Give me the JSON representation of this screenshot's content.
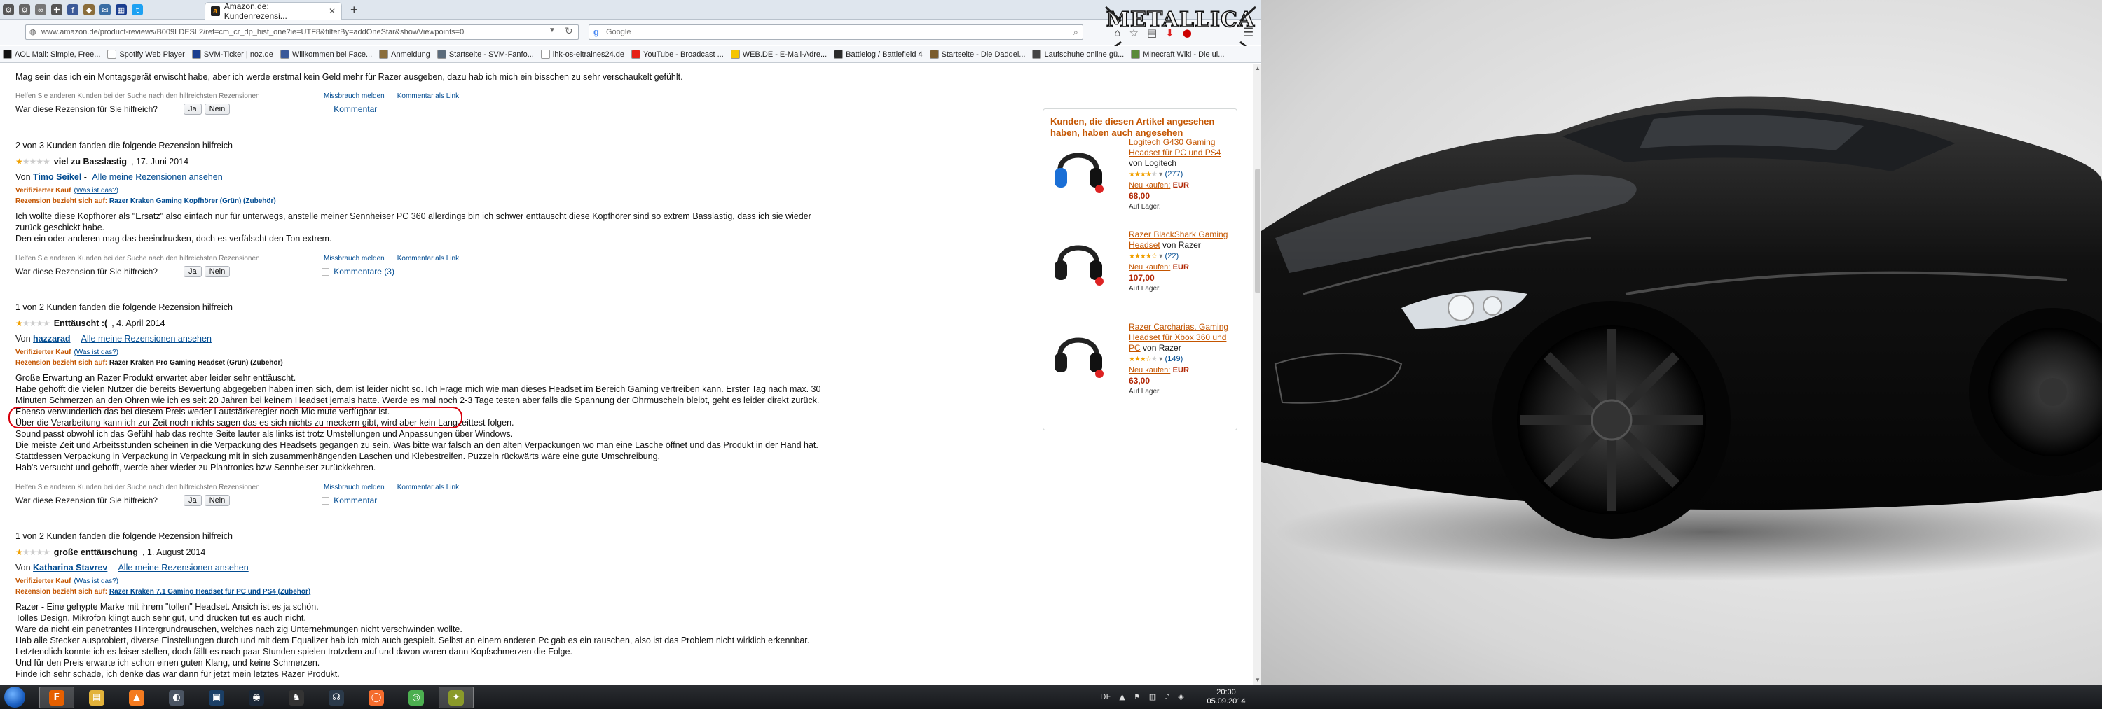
{
  "browser": {
    "tab_title": "Amazon.de: Kundenrezensi...",
    "url": "www.amazon.de/product-reviews/B009LDESL2/ref=cm_cr_dp_hist_one?ie=UTF8&filterBy=addOneStar&showViewpoints=0",
    "search_placeholder": "Google",
    "overlay_logo_text": "METALLICA"
  },
  "bookmarks": [
    {
      "label": "AOL Mail: Simple, Free...",
      "color": "#111111"
    },
    {
      "label": "Spotify Web Player",
      "color": "#ffffff"
    },
    {
      "label": "SVM-Ticker | noz.de",
      "color": "#1a3d8f"
    },
    {
      "label": "Willkommen bei Face...",
      "color": "#3b5998"
    },
    {
      "label": "Anmeldung",
      "color": "#8a6d3b"
    },
    {
      "label": "Startseite - SVM-Fanfo...",
      "color": "#5b6b7b"
    },
    {
      "label": "ihk-os-eltraines24.de",
      "color": "#ffffff"
    },
    {
      "label": "YouTube - Broadcast ...",
      "color": "#e62117"
    },
    {
      "label": "WEB.DE - E-Mail-Adre...",
      "color": "#f5c400"
    },
    {
      "label": "Battlelog / Battlefield 4",
      "color": "#2b2b2b"
    },
    {
      "label": "Startseite - Die Daddel...",
      "color": "#7a5c2e"
    },
    {
      "label": "Laufschuhe online gü...",
      "color": "#444444"
    },
    {
      "label": "Minecraft Wiki - Die ul...",
      "color": "#5a8a3a"
    }
  ],
  "reviews": {
    "top_text": "Mag sein das ich ein Montagsgerät erwischt habe, aber ich werde erstmal kein Geld mehr für Razer ausgeben, dazu hab ich mich ein bisschen zu sehr verschaukelt gefühlt.",
    "feedback_help_label": "Helfen Sie anderen Kunden bei der Suche nach den hilfreichsten Rezensionen",
    "report_abuse": "Missbrauch melden",
    "permalink": "Kommentar als Link",
    "helpful_question": "War diese Rezension für Sie hilfreich?",
    "yes": "Ja",
    "no": "Nein",
    "comment_1": "Kommentar",
    "verified_label": "Verifizierter Kauf",
    "what_is_this": "(Was ist das?)",
    "relates_label": "Rezension bezieht sich auf:",
    "all_reviews": "Alle meine Rezensionen ansehen",
    "r1": {
      "helpful": "2 von 3 Kunden fanden die folgende Rezension hilfreich",
      "title": "viel zu Basslastig",
      "date": ", 17. Juni 2014",
      "by": "Von",
      "author": "Timo Seikel",
      "product": "Razer Kraken Gaming Kopfhörer (Grün) (Zubehör)",
      "lines": [
        "Ich wollte diese Kopfhörer als \"Ersatz\" also einfach nur für unterwegs, anstelle meiner Sennheiser PC 360 allerdings bin ich schwer enttäuscht diese Kopfhörer sind so extrem Basslastig, dass ich sie wieder",
        "zurück geschickt habe.",
        "Den ein oder anderen mag das beeindrucken, doch es verfälscht den Ton extrem."
      ],
      "comments": "Kommentare (3)"
    },
    "r2": {
      "helpful": "1 von 2 Kunden fanden die folgende Rezension hilfreich",
      "title": "Enttäuscht :(",
      "date": ", 4. April 2014",
      "by": "Von",
      "author": "hazzarad",
      "product": "Razer Kraken Pro Gaming Headset (Grün) (Zubehör)",
      "lines": [
        "Große Erwartung an Razer Produkt erwartet aber leider sehr enttäuscht.",
        "Habe gehofft die vielen Nutzer die bereits Bewertung abgegeben haben irren sich, dem ist leider nicht so. Ich Frage mich wie man dieses Headset im Bereich Gaming vertreiben kann. Erster Tag nach max. 30",
        "Minuten Schmerzen an den Ohren wie ich es seit 20 Jahren bei keinem Headset jemals hatte. Werde es mal noch 2-3 Tage testen aber falls die Spannung der Ohrmuscheln bleibt, geht es leider direkt zurück.",
        "Ebenso verwunderlich das bei diesem Preis weder Lautstärkeregler noch Mic mute verfügbar ist.",
        "Über die Verarbeitung kann ich zur Zeit noch nichts sagen das es sich nichts zu meckern gibt, wird aber kein Langzeittest folgen.",
        "Sound passt obwohl ich das Gefühl hab das rechte Seite lauter als links ist trotz Umstellungen und Anpassungen über Windows.",
        "Die meiste Zeit und Arbeitsstunden scheinen in die Verpackung des Headsets gegangen zu sein. Was bitte war falsch an den alten Verpackungen wo man eine Lasche öffnet und das Produkt in der Hand hat.",
        "Stattdessen Verpackung in Verpackung in Verpackung mit in sich zusammenhängenden Laschen und Klebestreifen. Puzzeln rückwärts wäre eine gute Umschreibung.",
        "Hab's versucht und gehofft, werde aber wieder zu Plantronics bzw Sennheiser zurückkehren."
      ],
      "comments": "Kommentar"
    },
    "r3": {
      "helpful": "1 von 2 Kunden fanden die folgende Rezension hilfreich",
      "title": "große enttäuschung",
      "date": ", 1. August 2014",
      "by": "Von",
      "author": "Katharina Stavrev",
      "product": "Razer Kraken 7.1 Gaming Headset für PC und PS4 (Zubehör)",
      "lines": [
        "Razer - Eine gehypte Marke mit ihrem \"tollen\" Headset. Ansich ist es ja schön.",
        "Tolles Design, Mikrofon klingt auch sehr gut, und drücken tut es auch nicht.",
        "Wäre da nicht ein penetrantes Hintergrundrauschen, welches nach zig Unternehmungen nicht verschwinden wollte.",
        "Hab alle Stecker ausprobiert, diverse Einstellungen durch und mit dem Equalizer hab ich mich auch gespielt. Selbst an einem anderen Pc gab es ein rauschen, also ist das Problem nicht wirklich erkennbar.",
        "Letztendlich konnte ich es leiser stellen, doch fällt es nach paar Stunden spielen trotzdem auf und davon waren dann Kopfschmerzen die Folge.",
        "Und für den Preis erwarte ich schon einen guten Klang, und keine Schmerzen.",
        "Finde ich sehr schade, ich denke das war dann für jetzt mein letztes Razer Produkt."
      ]
    }
  },
  "widget": {
    "title": "Kunden, die diesen Artikel angesehen haben, haben auch angesehen",
    "buy_label": "Neu kaufen:",
    "currency": "EUR",
    "stock": "Auf Lager.",
    "items": [
      {
        "name": "Logitech G430 Gaming Headset für PC und PS4",
        "by": "von",
        "brand": "Logitech",
        "reviews": "(277)",
        "price": "68,00",
        "stars": 4
      },
      {
        "name": "Razer BlackShark Gaming Headset",
        "by": "von",
        "brand": "Razer",
        "reviews": "(22)",
        "price": "107,00",
        "stars": 4.5
      },
      {
        "name": "Razer Carcharias. Gaming Headset für Xbox 360 und PC",
        "by": "von",
        "brand": "Razer",
        "reviews": "(149)",
        "price": "63,00",
        "stars": 3.5
      }
    ]
  },
  "taskbar": {
    "lang": "DE",
    "time": "20:00",
    "date": "05.09.2014",
    "apps": [
      {
        "name": "firefox",
        "color": "#e66000",
        "glyph": "F"
      },
      {
        "name": "explorer",
        "color": "#e2b23a",
        "glyph": "▤"
      },
      {
        "name": "vlc",
        "color": "#f47b20",
        "glyph": "▲"
      },
      {
        "name": "steam-like",
        "color": "#4b5563",
        "glyph": "◐"
      },
      {
        "name": "terminal",
        "color": "#1b3f66",
        "glyph": "▣"
      },
      {
        "name": "steam",
        "color": "#1b2838",
        "glyph": "◉"
      },
      {
        "name": "game",
        "color": "#333333",
        "glyph": "♞"
      },
      {
        "name": "teamspeak",
        "color": "#2b3a4a",
        "glyph": "☊"
      },
      {
        "name": "origin",
        "color": "#f56c2d",
        "glyph": "◯"
      },
      {
        "name": "chrome",
        "color": "#4caf50",
        "glyph": "◎"
      },
      {
        "name": "battlelog",
        "color": "#8a9a2a",
        "glyph": "✦"
      }
    ]
  }
}
